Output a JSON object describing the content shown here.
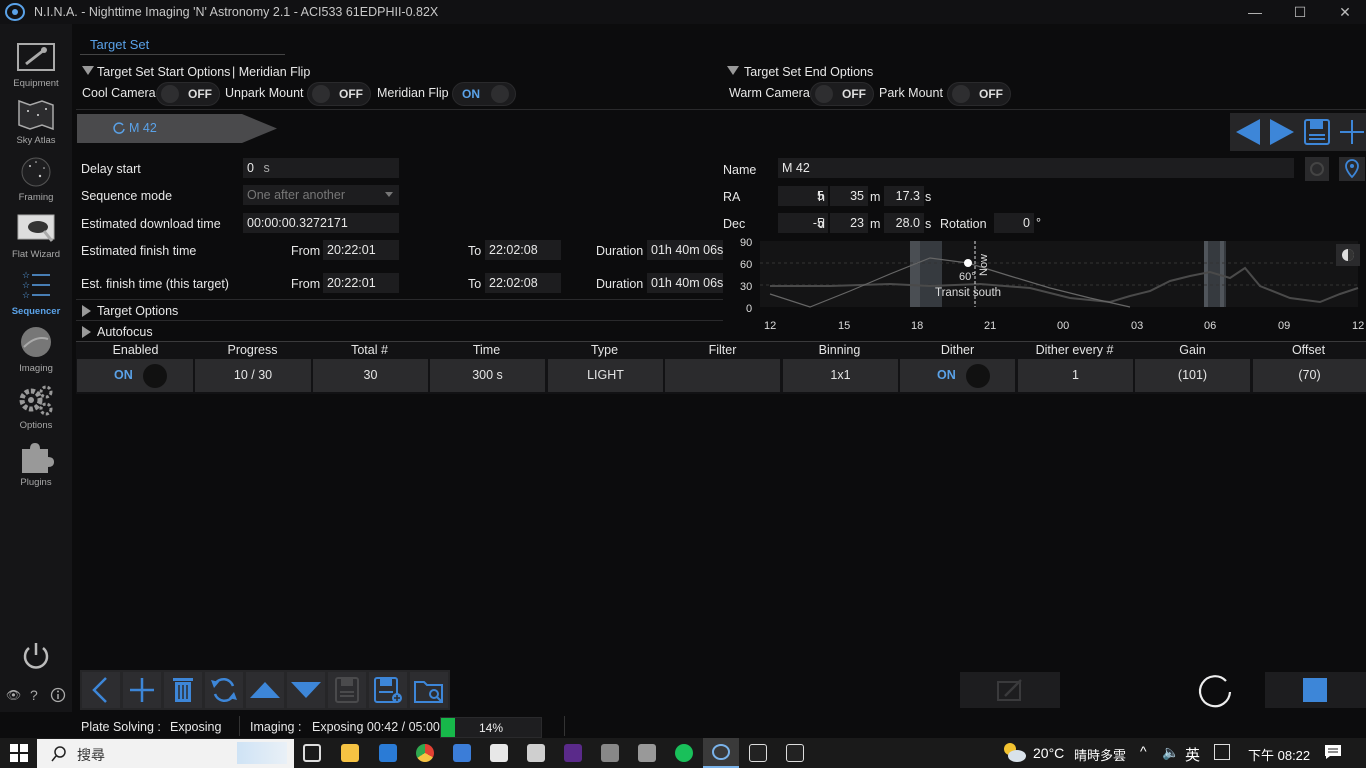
{
  "window": {
    "title": "N.I.N.A. - Nighttime Imaging 'N' Astronomy 2.1   -  ACI533 61EDPHII-0.82X",
    "controls": [
      "—",
      "☐",
      "✕"
    ]
  },
  "sidebar": {
    "items": [
      {
        "label": "Equipment",
        "icon": "telescope-icon"
      },
      {
        "label": "Sky Atlas",
        "icon": "sky-atlas-icon"
      },
      {
        "label": "Framing",
        "icon": "framing-icon"
      },
      {
        "label": "Flat Wizard",
        "icon": "flat-wizard-icon"
      },
      {
        "label": "Sequencer",
        "icon": "sequencer-icon",
        "active": true
      },
      {
        "label": "Imaging",
        "icon": "imaging-icon"
      },
      {
        "label": "Options",
        "icon": "gear-icon"
      },
      {
        "label": "Plugins",
        "icon": "puzzle-icon"
      }
    ],
    "collapse_label": "<<"
  },
  "target_set": {
    "tab_label": "Target Set",
    "start_options_label": "Target Set Start Options",
    "start_options_suffix": "| Meridian Flip",
    "end_options_label": "Target Set End Options",
    "toggles_start": [
      {
        "label": "Cool Camera",
        "state": "OFF"
      },
      {
        "label": "Unpark Mount",
        "state": "OFF"
      },
      {
        "label": "Meridian Flip",
        "state": "ON"
      }
    ],
    "toggles_end": [
      {
        "label": "Warm Camera",
        "state": "OFF"
      },
      {
        "label": "Park Mount",
        "state": "OFF"
      }
    ]
  },
  "target_tab": {
    "label": "M 42"
  },
  "target": {
    "delay_start_label": "Delay start",
    "delay_start_value": "0",
    "delay_start_unit": "s",
    "sequence_mode_label": "Sequence mode",
    "sequence_mode_value": "One after another",
    "download_time_label": "Estimated download time",
    "download_time_value": "00:00:00.3272171",
    "finish_label": "Estimated finish time",
    "finish_target_label": "Est. finish time (this target)",
    "from_label": "From",
    "to_label": "To",
    "duration_label": "Duration",
    "finish_from": "20:22:01",
    "finish_to": "22:02:08",
    "finish_duration": "01h 40m 06s",
    "target_from": "20:22:01",
    "target_to": "22:02:08",
    "target_duration": "01h 40m 06s",
    "target_options_label": "Target Options",
    "autofocus_label": "Autofocus"
  },
  "coords": {
    "name_label": "Name",
    "name_value": "M 42",
    "ra_label": "RA",
    "ra_h": "5",
    "ra_h_unit": "h",
    "ra_m": "35",
    "ra_m_unit": "m",
    "ra_s": "17.3",
    "ra_s_unit": "s",
    "dec_label": "Dec",
    "dec_d": "-5",
    "dec_d_unit": "d",
    "dec_m": "23",
    "dec_m_unit": "m",
    "dec_s": "28.0",
    "dec_s_unit": "s",
    "rotation_label": "Rotation",
    "rotation_value": "0",
    "rotation_unit": "°"
  },
  "altitude_chart": {
    "y_ticks": [
      "90",
      "60",
      "30",
      "0"
    ],
    "x_ticks": [
      "12",
      "15",
      "18",
      "21",
      "00",
      "03",
      "06",
      "09",
      "12"
    ],
    "now_label": "Now",
    "transit_label": "Transit south",
    "transit_alt": "60°",
    "colors": {
      "twilight": "#4a5058",
      "curve": "#5a5a5a",
      "horizon": "#444444"
    }
  },
  "exposure_table": {
    "headers": [
      "Enabled",
      "Progress",
      "Total #",
      "Time",
      "Type",
      "Filter",
      "Binning",
      "Dither",
      "Dither every #",
      "Gain",
      "Offset"
    ],
    "row": {
      "enabled": "ON",
      "progress": "10 / 30",
      "total": "30",
      "time": "300 s",
      "type": "LIGHT",
      "filter": "",
      "binning": "1x1",
      "dither": "ON",
      "dither_every": "1",
      "gain": "(101)",
      "offset": "(70)"
    }
  },
  "status": {
    "plate_solving_label": "Plate Solving :",
    "plate_solving_value": "Exposing",
    "imaging_label": "Imaging :",
    "imaging_value": "Exposing 00:42 / 05:00",
    "progress_text": "14%",
    "progress_fraction": 0.14
  },
  "taskbar": {
    "search_placeholder": "搜尋",
    "weather_temp": "20°C",
    "weather_text": "晴時多雲",
    "ime_label": "英",
    "time": "下午 08:22"
  },
  "accent": "#5aa2e8"
}
